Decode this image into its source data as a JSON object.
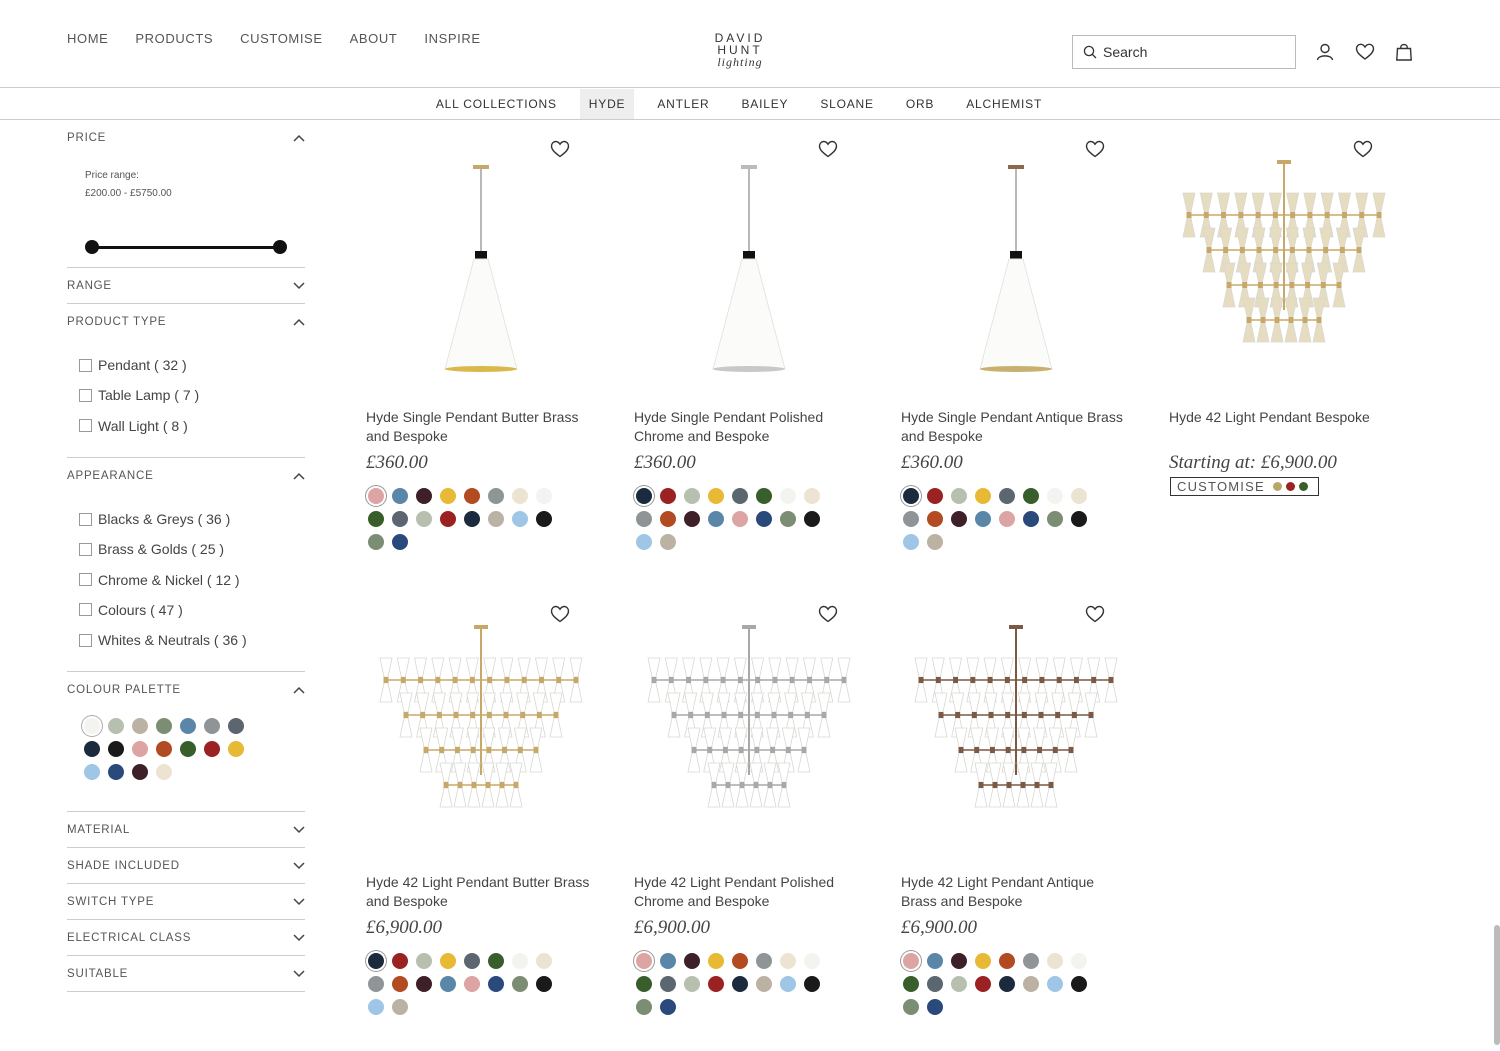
{
  "nav": {
    "home": "HOME",
    "products": "PRODUCTS",
    "customise": "CUSTOMISE",
    "about": "ABOUT",
    "inspire": "INSPIRE"
  },
  "logo": {
    "line1": "DAVID",
    "line2": "HUNT",
    "line3": "lighting"
  },
  "search": {
    "placeholder": "Search"
  },
  "header_icons": [
    "account-icon",
    "heart-icon",
    "bag-icon"
  ],
  "collections": [
    "ALL COLLECTIONS",
    "HYDE",
    "ANTLER",
    "BAILEY",
    "SLOANE",
    "ORB",
    "ALCHEMIST"
  ],
  "active_collection": "HYDE",
  "filters": {
    "price": {
      "title": "PRICE",
      "range_label": "Price range:",
      "range_value": "£200.00 - £5750.00",
      "min": 200,
      "max": 5750
    },
    "range": {
      "title": "RANGE"
    },
    "product_type": {
      "title": "PRODUCT TYPE",
      "options": [
        "Pendant ( 32 )",
        "Table Lamp ( 7 )",
        "Wall Light ( 8 )"
      ]
    },
    "appearance": {
      "title": "APPEARANCE",
      "options": [
        "Blacks & Greys ( 36 )",
        "Brass & Golds ( 25 )",
        "Chrome & Nickel ( 12 )",
        "Colours ( 47 )",
        "Whites & Neutrals ( 36 )"
      ]
    },
    "colour_palette": {
      "title": "COLOUR PALETTE",
      "colours": [
        "#f3f3f0",
        "#b7bfae",
        "#bcb2a3",
        "#7b8d73",
        "#5a87a8",
        "#8f9597",
        "#5c6670",
        "#1c2a3e",
        "#1a1a1a",
        "#dda4a4",
        "#b24b22",
        "#385f2b",
        "#9b2223",
        "#e7b934",
        "#9fc6e6",
        "#2b4a7c",
        "#3e2028",
        "#ede3d2"
      ]
    },
    "material": {
      "title": "MATERIAL"
    },
    "shade_included": {
      "title": "SHADE INCLUDED"
    },
    "switch_type": {
      "title": "SWITCH TYPE"
    },
    "electrical_class": {
      "title": "ELECTRICAL CLASS"
    },
    "suitable": {
      "title": "SUITABLE"
    }
  },
  "products": [
    {
      "name": "Hyde Single Pendant Butter Brass and Bespoke",
      "price": "£360.00",
      "fitting": "#c8a868",
      "inner": "#d9b84c",
      "swatches": [
        "#dda4a4",
        "#5a87a8",
        "#3e2028",
        "#e7b934",
        "#b24b22",
        "#8f9597",
        "#ede3d2",
        "#f3f3f0",
        "#385f2b",
        "#5c6670",
        "#b7bfae",
        "#9b2223",
        "#1c2a3e",
        "#bcb2a3",
        "#9fc6e6",
        "#1a1a1a",
        "#7b8d73",
        "#2b4a7c"
      ]
    },
    {
      "name": "Hyde Single Pendant Polished Chrome and Bespoke",
      "price": "£360.00",
      "fitting": "#bbbbbb",
      "inner": "#c8c8c8",
      "swatches": [
        "#1c2a3e",
        "#9b2223",
        "#b7bfae",
        "#e7b934",
        "#5c6670",
        "#385f2b",
        "#f3f3f0",
        "#ede3d2",
        "#8f9597",
        "#b24b22",
        "#3e2028",
        "#5a87a8",
        "#dda4a4",
        "#2b4a7c",
        "#7b8d73",
        "#1a1a1a",
        "#9fc6e6",
        "#bcb2a3"
      ]
    },
    {
      "name": "Hyde Single Pendant Antique Brass and Bespoke",
      "price": "£360.00",
      "fitting": "#8a6a4e",
      "inner": "#c8b070",
      "swatches": [
        "#1c2a3e",
        "#9b2223",
        "#b7bfae",
        "#e7b934",
        "#5c6670",
        "#385f2b",
        "#f3f3f0",
        "#ede3d2",
        "#8f9597",
        "#b24b22",
        "#3e2028",
        "#5a87a8",
        "#dda4a4",
        "#2b4a7c",
        "#7b8d73",
        "#1a1a1a",
        "#9fc6e6",
        "#bcb2a3"
      ]
    },
    {
      "name": "Hyde 42 Light Pendant Bespoke",
      "price": "Starting at: £6,900.00",
      "customise_label": "CUSTOMISE",
      "customise_dots": [
        "#b7a86a",
        "#9b2223",
        "#385f2b"
      ],
      "fitting": "#c8a868",
      "shade": "#e6dcc0"
    },
    {
      "name": "Hyde 42 Light Pendant Butter Brass and Bespoke",
      "price": "£6,900.00",
      "fitting": "#c8a868",
      "shade": "#ffffff",
      "swatches": [
        "#1c2a3e",
        "#9b2223",
        "#b7bfae",
        "#e7b934",
        "#5c6670",
        "#385f2b",
        "#f3f3f0",
        "#ede3d2",
        "#8f9597",
        "#b24b22",
        "#3e2028",
        "#5a87a8",
        "#dda4a4",
        "#2b4a7c",
        "#7b8d73",
        "#1a1a1a",
        "#9fc6e6",
        "#bcb2a3"
      ]
    },
    {
      "name": "Hyde 42 Light Pendant Polished Chrome and Bespoke",
      "price": "£6,900.00",
      "fitting": "#a8a8a8",
      "shade": "#ffffff",
      "swatches": [
        "#dda4a4",
        "#5a87a8",
        "#3e2028",
        "#e7b934",
        "#b24b22",
        "#8f9597",
        "#ede3d2",
        "#f3f3f0",
        "#385f2b",
        "#5c6670",
        "#b7bfae",
        "#9b2223",
        "#1c2a3e",
        "#bcb2a3",
        "#9fc6e6",
        "#1a1a1a",
        "#7b8d73",
        "#2b4a7c"
      ]
    },
    {
      "name": "Hyde 42 Light Pendant Antique Brass and Bespoke",
      "price": "£6,900.00",
      "fitting": "#7a5a44",
      "shade": "#ffffff",
      "swatches": [
        "#dda4a4",
        "#5a87a8",
        "#3e2028",
        "#e7b934",
        "#b24b22",
        "#8f9597",
        "#ede3d2",
        "#f3f3f0",
        "#385f2b",
        "#5c6670",
        "#b7bfae",
        "#9b2223",
        "#1c2a3e",
        "#bcb2a3",
        "#9fc6e6",
        "#1a1a1a",
        "#7b8d73",
        "#2b4a7c"
      ]
    }
  ]
}
